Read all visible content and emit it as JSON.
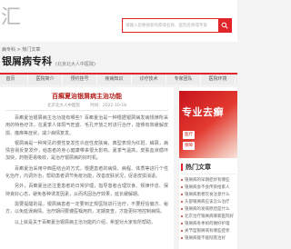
{
  "header": {
    "logo_text": "汇",
    "search_placeholder": "请输入您要搜索的疾病名称、医院名称或专家",
    "search_icon": "search-icon"
  },
  "breadcrumb": "病专科 > 热门文章",
  "site": {
    "title": "银屑病专科",
    "subtitle": "(北京北大人中医院)"
  },
  "nav": [
    "首页",
    "医院简介",
    "预约挂号",
    "疾病知识",
    "诊疗技术",
    "专家团队",
    "医院环境"
  ],
  "article": {
    "title": "百癣夏治银屑病主治功能",
    "source": "北京北大人中医院",
    "date": "时间：2022-10-18",
    "paragraphs": [
      "百癣夏治银屑病主治功能有哪些？百癣夏治是一种根据银屑病发病规律所采用的特色疗法，在夏季人体阳气旺盛、毛孔开放之时进行治疗，能够有效缓解皮损、瘙痒等症状，减少病情复发。",
      "银屑病是一种常见的慢性复发性炎症性皮肤病，典型表现为红斑、鳞屑，病情容易反复发作，给患者的身心健康带来很大影响。夏季气温高，皮肤血液循环加快，药物更易吸收，是治疗银屑病的好时机。",
      "百癣夏治采用中西医结合的方式，根据患者的病情、病程、体质等进行个性化治疗，内调外治，帮助患者调节免疫功能，改善皮肤状况，促进皮损消退。",
      "另外，百癣夏治还注重患者的日常护理，指导患者合理饮食、规律作息、保持良好心态，避免各种诱发因素，从而巩固治疗效果，延长缓解期。",
      "需要提醒的是，银屑病患者一定要到正规医院进行治疗，不要轻信偏方、秘方，以免延误病情。治疗期间要遵医嘱用药，定期复查，才能更好地控制病情。",
      "以上就是关于百癣夏治银屑病主治功能的介绍，希望对大家有所帮助。"
    ]
  },
  "sidebar": {
    "ad": {
      "headline": "专业去癣",
      "badges": [
        "医疗",
        "保障"
      ]
    },
    "hot_title": "热门文章",
    "hot_articles": [
      "银屑病的早期症状有哪些",
      "银屑病会不会传染给家人",
      "银屑病患者饮食注意什么",
      "头部银屑病应该怎么治疗",
      "银屑病的发病原因是什么",
      "北京治疗银屑病哪家医院好",
      "银屑病冬季如何做好护理",
      "关节型银屑病有哪些症状",
      "银屑病能不能彻底治好"
    ]
  },
  "colors": {
    "accent": "#e0262b",
    "title": "#b3201c"
  }
}
